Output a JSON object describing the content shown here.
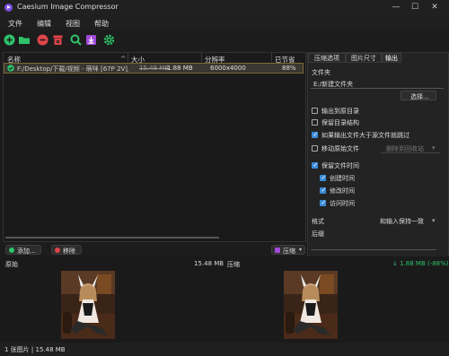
{
  "window": {
    "title": "Caesium Image Compressor",
    "controls": {
      "minimize": "—",
      "maximize": "☐",
      "close": "✕"
    }
  },
  "menu": [
    "文件",
    "编辑",
    "视图",
    "帮助"
  ],
  "toolbar": {
    "icons": [
      "add-icon",
      "folder-icon",
      "remove-icon",
      "clear-icon",
      "search-icon",
      "import-icon",
      "settings-icon"
    ],
    "colors": {
      "green": "#2ec26a",
      "red": "#e0454a",
      "purple": "#a04ad8"
    }
  },
  "table": {
    "headers": [
      "名称",
      "大小",
      "分辨率",
      "已节省"
    ],
    "rows": [
      {
        "name": "F:/Desktop/下载/视频 - 萌咪 [67P 2V],",
        "old_size": "15.48 MB",
        "new_size": "1.88 MB",
        "resolution": "6000x4000",
        "saved": "88%"
      }
    ]
  },
  "buttons": {
    "add": "添加...",
    "remove": "移除",
    "compress": "压缩"
  },
  "tabs": [
    "压缩选项",
    "图片尺寸",
    "输出"
  ],
  "output": {
    "folder_label": "文件夹",
    "folder_value": "E:/新建文件夹",
    "browse": "选择...",
    "output_to_source": "输出到原目录",
    "keep_structure": "保留目录结构",
    "skip_larger": "如果输出文件大于源文件就跳过",
    "move_original": "移动原始文件",
    "move_target": "删除到回收站",
    "keep_dates": "保留文件时间",
    "created": "创建时间",
    "modified": "修改时间",
    "accessed": "访问时间",
    "format_label": "格式",
    "format_value": "和输入保持一致",
    "suffix_label": "后缀"
  },
  "preview": {
    "original_label": "原始",
    "original_size": "15.48 MB",
    "compressed_label": "压缩",
    "compressed_size": "↓ 1.88 MB (-88%)"
  },
  "status": "1 张图片 | 15.48 MB"
}
